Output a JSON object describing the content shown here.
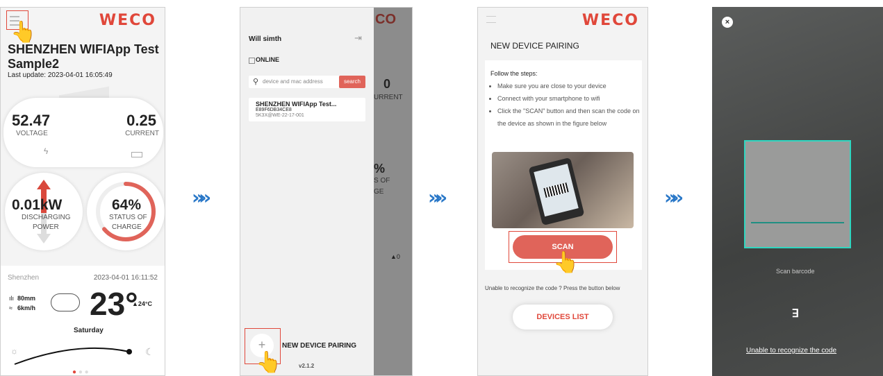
{
  "brand": "WECO",
  "screen1": {
    "device_title": "SHENZHEN WIFIApp Test Sample2",
    "last_update": "Last update:  2023-04-01 16:05:49",
    "voltage_value": "52.47",
    "voltage_label": "VOLTAGE",
    "current_value": "0.25",
    "current_label": "CURRENT",
    "power_value": "0.01kW",
    "power_label1": "DISCHARGING",
    "power_label2": "POWER",
    "soc_value": "64%",
    "soc_percent": 64,
    "soc_label1": "STATUS OF",
    "soc_label2": "CHARGE",
    "city": "Shenzhen",
    "datetime": "2023-04-01 16:11:52",
    "rain": "80mm",
    "wind": "6km/h",
    "temperature": "23°",
    "temp_high": "▲24°C",
    "day": "Saturday"
  },
  "screen2": {
    "user_name": "Will simth",
    "online_label": "ONLINE",
    "search_placeholder": "device and mac address",
    "search_button": "search",
    "device_name": "SHENZHEN WIFIApp Test...",
    "device_mac": "E89F6DB34CE8",
    "device_serial": "5K3X@WE-22-17-001",
    "bg_value": "0",
    "bg_current": "URRENT",
    "bg_pct": "%",
    "bg_of": "S OF",
    "bg_ge": "GE",
    "bg_up": "▲0",
    "add_label": "NEW DEVICE PAIRING",
    "version": "v2.1.2"
  },
  "screen3": {
    "title": "NEW DEVICE PAIRING",
    "steps_title": "Follow the steps:",
    "steps": [
      "Make sure you are close to your device",
      "Connect with your smartphone to wifi",
      "Click the \"SCAN\" button and then scan the code on the device as shown in the figure below"
    ],
    "scan_button": "SCAN",
    "unable_text": "Unable to recognize the code ? Press the button below",
    "devices_list_button": "DEVICES LIST"
  },
  "screen4": {
    "scan_label": "Scan barcode",
    "unable_link": "Unable to recognize the code"
  },
  "arrows": [
    "»»",
    "»»",
    "»»"
  ]
}
